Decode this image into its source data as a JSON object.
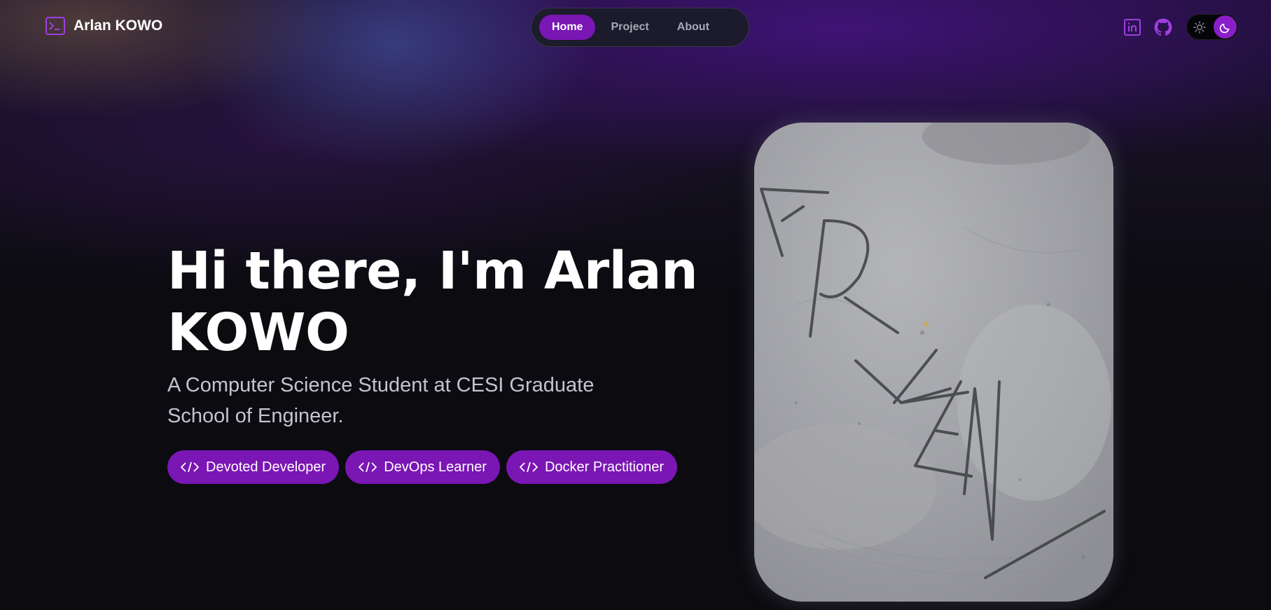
{
  "brand": {
    "name": "Arlan KOWO",
    "icon": "terminal-icon"
  },
  "nav": {
    "items": [
      {
        "label": "Home",
        "active": true
      },
      {
        "label": "Project",
        "active": false
      },
      {
        "label": "About",
        "active": false
      }
    ]
  },
  "social": {
    "linkedin_icon": "linkedin-icon",
    "github_icon": "github-icon"
  },
  "theme_toggle": {
    "light_icon": "sun-icon",
    "dark_icon": "moon-icon",
    "selected": "dark"
  },
  "hero": {
    "title": "Hi there, I'm Arlan KOWO",
    "subtitle": "A Computer Science Student at CESI Graduate School of Engineer.",
    "tags": [
      {
        "label": "Devoted Developer",
        "icon": "code-icon"
      },
      {
        "label": "DevOps Learner",
        "icon": "code-icon"
      },
      {
        "label": "Docker Practitioner",
        "icon": "code-icon"
      }
    ],
    "photo_text": "ARLAN"
  },
  "colors": {
    "accent": "#7a16b4",
    "background": "#0b0b10",
    "nav_background": "#1a1c28"
  }
}
